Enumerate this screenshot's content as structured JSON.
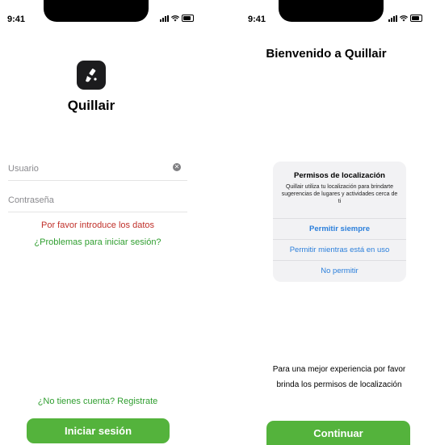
{
  "status": {
    "time": "9:41"
  },
  "login": {
    "app_name": "Quillair",
    "username_placeholder": "Usuario",
    "password_placeholder": "Contraseña",
    "error_text": "Por favor introduce los datos",
    "trouble_link": "¿Problemas para iniciar sesión?",
    "register_link": "¿No tienes cuenta? Registrate",
    "login_button": "Iniciar sesión"
  },
  "permissions": {
    "welcome_title": "Bienvenido a Quillair",
    "alert_title": "Permisos de localización",
    "alert_message": "Quillair utiliza tu localización para brindarte sugerencias de lugares y actividades cerca de ti",
    "option_always": "Permitir siempre",
    "option_while_using": "Permitir mientras está en uso",
    "option_deny": "No permitir",
    "info_text": "Para una mejor experiencia por favor brinda los permisos de localización",
    "continue_button": "Continuar"
  },
  "colors": {
    "accent_green": "#54b33c",
    "error_red": "#c0302a",
    "link_blue": "#2b7fdb",
    "link_green": "#2f9e2f"
  }
}
